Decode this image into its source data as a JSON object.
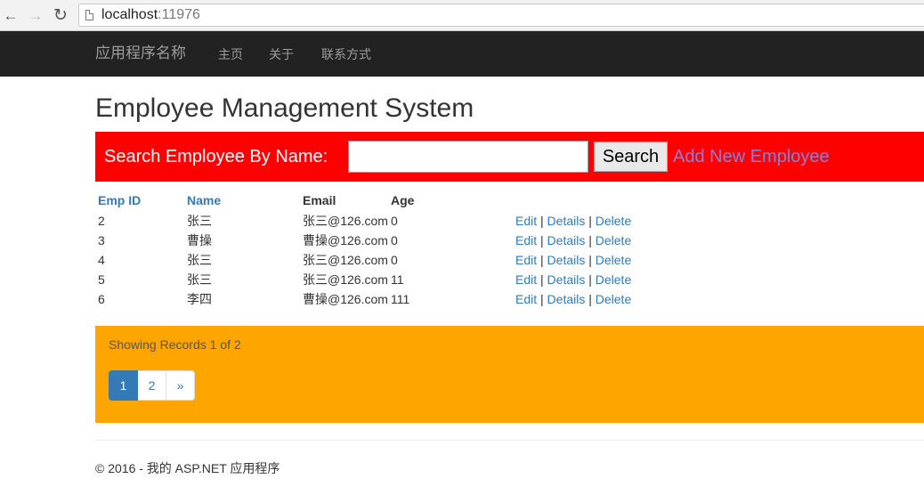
{
  "browser": {
    "url_host": "localhost",
    "url_port": ":11976",
    "back_glyph": "←",
    "forward_glyph": "→",
    "reload_glyph": "↻",
    "icons": [
      "back-arrow-icon",
      "forward-arrow-icon",
      "reload-icon",
      "page-icon"
    ]
  },
  "navbar": {
    "brand": "应用程序名称",
    "links": [
      "主页",
      "关于",
      "联系方式"
    ],
    "background": "#222222"
  },
  "page": {
    "title": "Employee Management System"
  },
  "search": {
    "label": "Search Employee By Name:",
    "input_value": "",
    "button_label": "Search",
    "add_link": "Add New Employee",
    "background": "#ff0000"
  },
  "table": {
    "headers": {
      "id": "Emp ID",
      "name": "Name",
      "email": "Email",
      "age": "Age"
    },
    "rows": [
      {
        "id": "2",
        "name": "张三",
        "email": "张三@126.com",
        "age": "0"
      },
      {
        "id": "3",
        "name": "曹操",
        "email": "曹操@126.com",
        "age": "0"
      },
      {
        "id": "4",
        "name": "张三",
        "email": "张三@126.com",
        "age": "0"
      },
      {
        "id": "5",
        "name": "张三",
        "email": "张三@126.com",
        "age": "11"
      },
      {
        "id": "6",
        "name": "李四",
        "email": "曹操@126.com",
        "age": "111"
      }
    ],
    "actions": {
      "edit": "Edit",
      "details": "Details",
      "delete": "Delete",
      "separator": "|"
    }
  },
  "pager": {
    "records_text": "Showing Records 1 of 2",
    "pages": [
      "1",
      "2",
      "»"
    ],
    "active_page": "1",
    "background": "#ffa500"
  },
  "footer": {
    "text": "© 2016 - 我的 ASP.NET 应用程序"
  }
}
